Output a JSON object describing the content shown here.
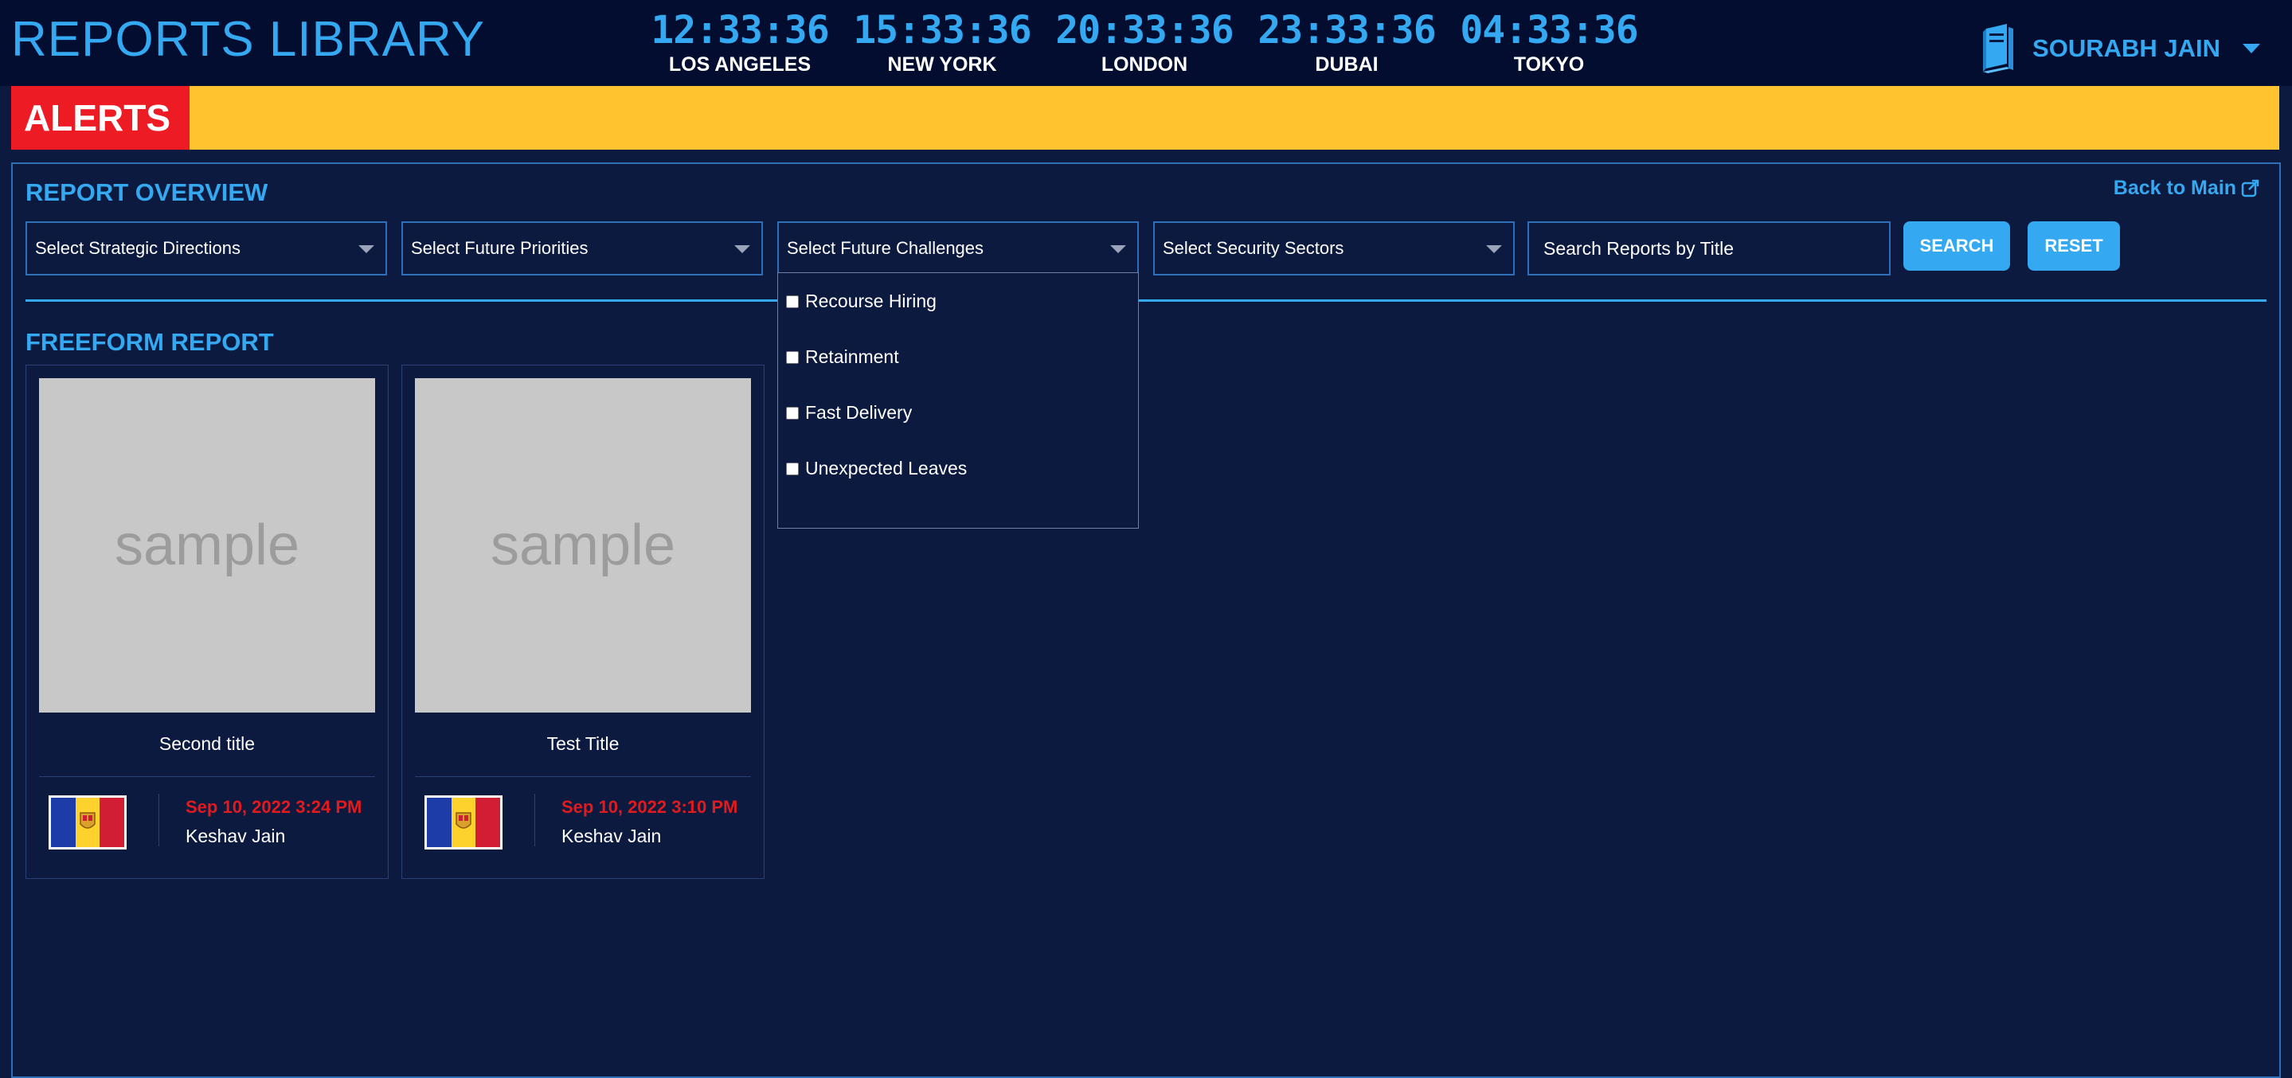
{
  "header": {
    "app_title": "REPORTS LIBRARY",
    "clocks": [
      {
        "time": "12:33:36",
        "city": "LOS ANGELES"
      },
      {
        "time": "15:33:36",
        "city": "NEW YORK"
      },
      {
        "time": "20:33:36",
        "city": "LONDON"
      },
      {
        "time": "23:33:36",
        "city": "DUBAI"
      },
      {
        "time": "04:33:36",
        "city": "TOKYO"
      }
    ],
    "user_name": "SOURABH JAIN"
  },
  "alerts": {
    "label": "ALERTS"
  },
  "overview": {
    "title": "REPORT OVERVIEW",
    "back_link": "Back to Main",
    "filters": {
      "strategic_directions": "Select Strategic Directions",
      "future_priorities": "Select Future Priorities",
      "future_challenges": "Select Future Challenges",
      "security_sectors": "Select Security Sectors"
    },
    "search_placeholder": "Search Reports by Title",
    "search_button": "SEARCH",
    "reset_button": "RESET",
    "challenges_options": [
      {
        "label": "Recourse Hiring",
        "checked": false
      },
      {
        "label": "Retainment",
        "checked": false
      },
      {
        "label": "Fast Delivery",
        "checked": false
      },
      {
        "label": "Unexpected Leaves",
        "checked": false
      }
    ]
  },
  "freeform": {
    "title": "FREEFORM REPORT",
    "cards": [
      {
        "image_text": "sample",
        "title": "Second title",
        "date": "Sep 10, 2022 3:24 PM",
        "author": "Keshav Jain"
      },
      {
        "image_text": "sample",
        "title": "Test Title",
        "date": "Sep 10, 2022 3:10 PM",
        "author": "Keshav Jain"
      }
    ]
  },
  "colors": {
    "accent": "#34a8f0",
    "background": "#0c1a40",
    "alert_yellow": "#fec32f",
    "alert_red": "#ed1c24",
    "date_red": "#e11a1e"
  },
  "icons": {
    "user": "book-icon",
    "back": "external-link-icon",
    "caret": "chevron-down-icon",
    "flag": "andorra-flag-icon"
  }
}
